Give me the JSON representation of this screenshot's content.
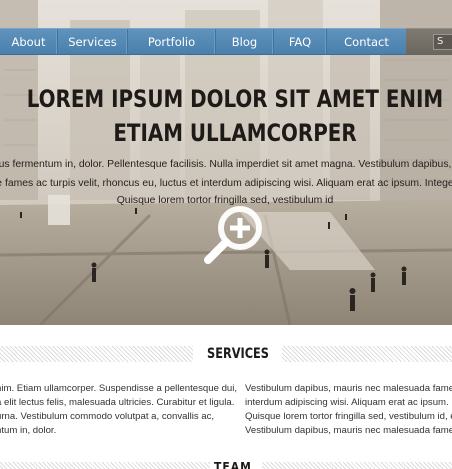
{
  "nav": {
    "items": [
      "About",
      "Services",
      "Portfolio",
      "Blog",
      "FAQ",
      "Contact"
    ],
    "search_fragment": "S"
  },
  "hero": {
    "headline_line1": "LOREM IPSUM DOLOR SIT AMET ENIM",
    "headline_line2": "ETIAM ULLAMCORPER",
    "text_lines": [
      "Phasellus fermentum in, dolor. Pellentesque facilisis. Nulla imperdiet sit amet magna. Vestibulum dapibus, mauris",
      "Fusce fames ac turpis velit, rhoncus eu, luctus et interdum adipiscing wisi. Aliquam erat ac ipsum. Integer aliq",
      "Quisque lorem tortor fringilla sed, vestibulum id"
    ],
    "zoom_icon": "magnifier-plus-icon"
  },
  "services": {
    "title": "SERVICES",
    "left_lines": [
      "nim. Etiam ullamcorper. Suspendisse a pellentesque dui,",
      "a elit lectus felis, malesuada ultricies. Curabitur et ligula.",
      "urna. Vestibulum commodo volutpat a, convallis ac,",
      "ntum in, dolor."
    ],
    "right_lines": [
      "Vestibulum dapibus, mauris nec malesuada fames ac",
      "interdum adipiscing wisi. Aliquam erat ac ipsum. Integ",
      "Quisque lorem tortor fringilla sed, vestibulum id, eleif",
      "Vestibulum dapibus, mauris nec malesuada fames ac"
    ]
  },
  "next_section": {
    "title_fragment": "TEAM"
  },
  "colors": {
    "nav_blue": "#4a80ac",
    "search_gray": "#6a655d",
    "heading_dark": "#1d1a17"
  }
}
